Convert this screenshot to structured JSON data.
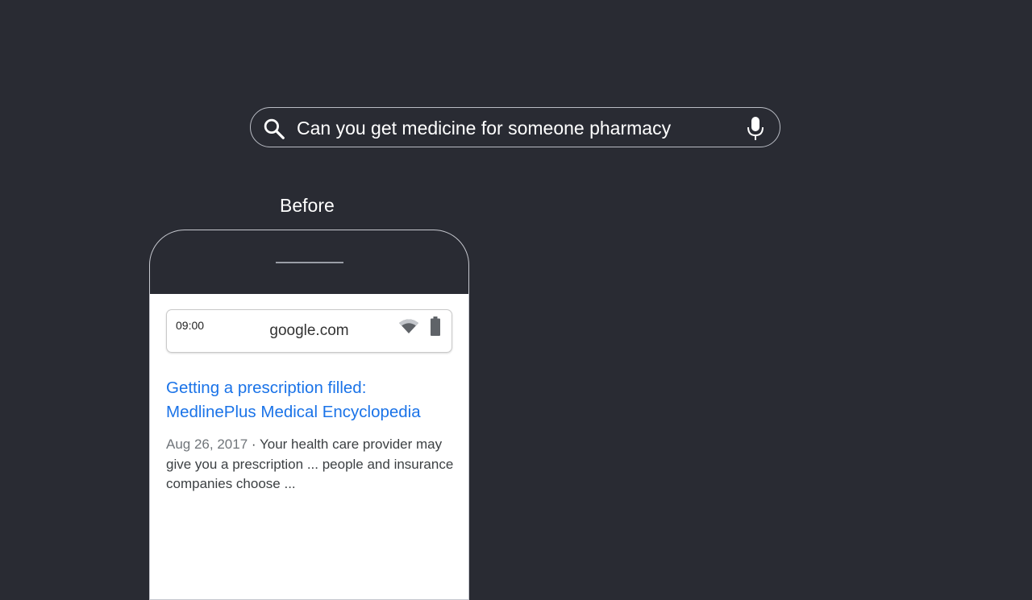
{
  "search": {
    "query": "Can you get medicine for someone pharmacy",
    "search_icon": "search-icon",
    "mic_icon": "mic-icon"
  },
  "comparison_label": "Before",
  "phone": {
    "status": {
      "time": "09:00",
      "url": "google.com",
      "wifi_icon": "wifi-icon",
      "battery_icon": "battery-icon"
    },
    "result": {
      "title": "Getting a prescription filled: MedlinePlus Medical Encyclopedia",
      "date": "Aug 26, 2017",
      "separator": " · ",
      "snippet": "Your health care provider may give you a prescription ... people and insurance companies choose ..."
    }
  },
  "colors": {
    "background": "#292b33",
    "link": "#1a73e8",
    "screen": "#ffffff"
  }
}
